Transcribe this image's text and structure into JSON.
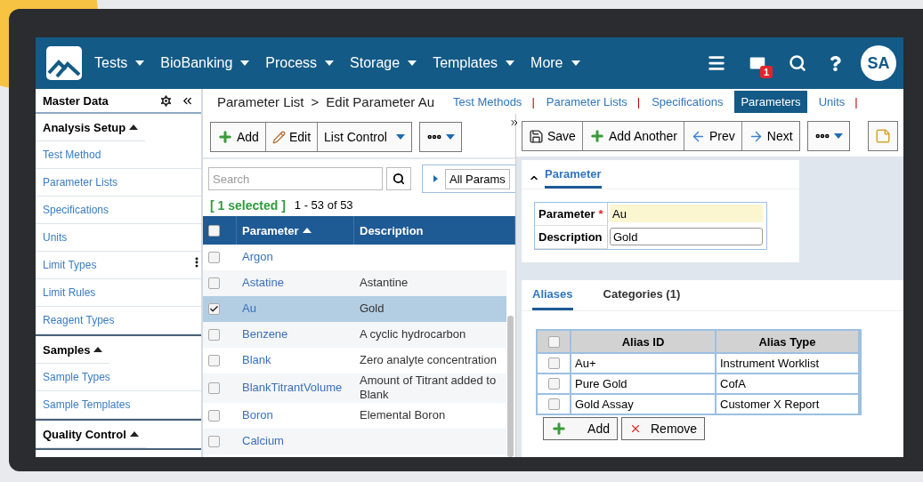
{
  "nav": {
    "menus": [
      {
        "label": "Tests"
      },
      {
        "label": "BioBanking"
      },
      {
        "label": "Process"
      },
      {
        "label": "Storage"
      },
      {
        "label": "Templates"
      },
      {
        "label": "More"
      }
    ],
    "mail_count": "1",
    "avatar": "SA"
  },
  "sidebar": {
    "title": "Master Data",
    "sections": [
      {
        "title": "Analysis Setup",
        "expanded": true,
        "items": [
          {
            "label": "Test Method"
          },
          {
            "label": "Parameter Lists"
          },
          {
            "label": "Specifications"
          },
          {
            "label": "Units"
          },
          {
            "label": "Limit Types"
          },
          {
            "label": "Limit Rules"
          },
          {
            "label": "Reagent Types"
          }
        ]
      },
      {
        "title": "Samples",
        "expanded": true,
        "items": [
          {
            "label": "Sample Types"
          },
          {
            "label": "Sample Templates"
          }
        ]
      },
      {
        "title": "Quality Control",
        "expanded": true
      }
    ]
  },
  "breadcrumb": [
    {
      "label": "Parameter List"
    },
    {
      "label": ">"
    },
    {
      "label": "Edit Parameter Au"
    }
  ],
  "section_tabs": [
    {
      "label": "Test Methods",
      "selected": false,
      "divider": "|"
    },
    {
      "label": "Parameter Lists",
      "selected": false,
      "divider": "|"
    },
    {
      "label": "Specifications",
      "selected": false
    },
    {
      "label": "Parameters",
      "selected": true
    },
    {
      "label": "Units",
      "selected": false,
      "divider": "|"
    }
  ],
  "list": {
    "toolbar": [
      {
        "kind": "add",
        "label": "Add"
      },
      {
        "kind": "edit",
        "label": "Edit"
      },
      {
        "kind": "dropdown",
        "label": "List Control"
      }
    ],
    "search": {
      "placeholder": "Search"
    },
    "filter": "All Params",
    "selection": "[ 1 selected ]",
    "count": "1 - 53 of 53",
    "all_checked": false,
    "columns": [
      {
        "label": "Parameter",
        "sorted": true
      },
      {
        "label": "Description",
        "sorted": false
      }
    ],
    "rows": [
      {
        "name": "Argon",
        "checked": false,
        "selected": false
      },
      {
        "name": "Astatine",
        "description": "Astantine",
        "checked": false,
        "selected": false
      },
      {
        "name": "Au",
        "description": "Gold",
        "checked": true,
        "selected": true
      },
      {
        "name": "Benzene",
        "description": "A cyclic hydrocarbon",
        "checked": false,
        "selected": false
      },
      {
        "name": "Blank",
        "description": "Zero analyte concentration",
        "checked": false,
        "selected": false
      },
      {
        "name": "BlankTitrantVolume",
        "description": "Amount of Titrant added to Blank",
        "checked": false,
        "selected": false
      },
      {
        "name": "Boron",
        "description": "Elemental Boron",
        "checked": false,
        "selected": false
      },
      {
        "name": "Calcium",
        "checked": false,
        "selected": false
      }
    ]
  },
  "editor": {
    "toolbar": [
      {
        "kind": "save",
        "label": "Save"
      },
      {
        "kind": "add",
        "label": "Add Another"
      },
      {
        "kind": "prev",
        "label": "Prev"
      },
      {
        "kind": "next",
        "label": "Next"
      }
    ],
    "section": {
      "title": "Parameter",
      "expanded": true,
      "fields": [
        {
          "label": "Parameter",
          "required_mark": "*",
          "value": "Au"
        },
        {
          "label": "Description",
          "value": "Gold"
        }
      ]
    },
    "tabs": [
      {
        "label": "Aliases",
        "selected": true
      },
      {
        "label": "Categories (1)",
        "selected": false
      }
    ],
    "aliases_all_checked": false,
    "alias_columns": [
      "Alias ID",
      "Alias Type"
    ],
    "aliases": [
      {
        "id": "Au+",
        "type": "Instrument Worklist",
        "checked": false
      },
      {
        "id": "Pure Gold",
        "type": "CofA",
        "checked": false
      },
      {
        "id": "Gold Assay",
        "type": "Customer X Report",
        "checked": false
      }
    ],
    "alias_buttons": [
      {
        "kind": "add",
        "label": "Add"
      },
      {
        "kind": "remove",
        "label": "Remove"
      }
    ]
  }
}
